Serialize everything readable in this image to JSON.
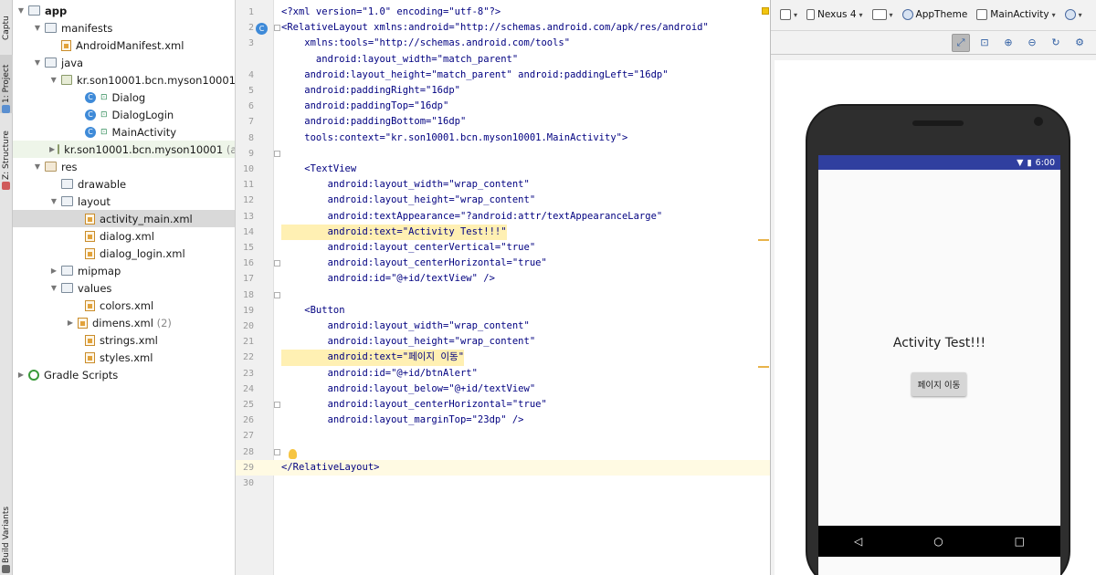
{
  "side_tabs": {
    "capture": "Captu",
    "project": "1: Project",
    "structure": "Z: Structure",
    "build_variants": "Build Variants"
  },
  "tree": {
    "app": "app",
    "manifests": "manifests",
    "android_manifest": "AndroidManifest.xml",
    "java": "java",
    "pkg1": "kr.son10001.bcn.myson10001",
    "dialog": "Dialog",
    "dialog_login": "DialogLogin",
    "main_activity": "MainActivity",
    "pkg2": "kr.son10001.bcn.myson10001",
    "pkg2_suffix": "(an",
    "res": "res",
    "drawable": "drawable",
    "layout": "layout",
    "activity_main": "activity_main.xml",
    "dialog_xml": "dialog.xml",
    "dialog_login_xml": "dialog_login.xml",
    "mipmap": "mipmap",
    "values": "values",
    "colors": "colors.xml",
    "dimens": "dimens.xml",
    "dimens_count": "(2)",
    "strings": "strings.xml",
    "styles": "styles.xml",
    "gradle": "Gradle Scripts"
  },
  "editor": {
    "lines": [
      {
        "n": "1",
        "t": "<?xml version=\"1.0\" encoding=\"utf-8\"?>"
      },
      {
        "n": "2",
        "t": "<RelativeLayout xmlns:android=\"http://schemas.android.com/apk/res/android\""
      },
      {
        "n": "3",
        "t": "    xmlns:tools=\"http://schemas.android.com/tools\""
      },
      {
        "n": "",
        "t": "      android:layout_width=\"match_parent\""
      },
      {
        "n": "4",
        "t": "    android:layout_height=\"match_parent\" android:paddingLeft=\"16dp\""
      },
      {
        "n": "5",
        "t": "    android:paddingRight=\"16dp\""
      },
      {
        "n": "6",
        "t": "    android:paddingTop=\"16dp\""
      },
      {
        "n": "7",
        "t": "    android:paddingBottom=\"16dp\""
      },
      {
        "n": "8",
        "t": "    tools:context=\"kr.son10001.bcn.myson10001.MainActivity\">"
      },
      {
        "n": "9",
        "t": ""
      },
      {
        "n": "10",
        "t": "    <TextView"
      },
      {
        "n": "11",
        "t": "        android:layout_width=\"wrap_content\""
      },
      {
        "n": "12",
        "t": "        android:layout_height=\"wrap_content\""
      },
      {
        "n": "13",
        "t": "        android:textAppearance=\"?android:attr/textAppearanceLarge\""
      },
      {
        "n": "14",
        "t": "        android:text=\"Activity Test!!!\""
      },
      {
        "n": "15",
        "t": "        android:layout_centerVertical=\"true\""
      },
      {
        "n": "16",
        "t": "        android:layout_centerHorizontal=\"true\""
      },
      {
        "n": "17",
        "t": "        android:id=\"@+id/textView\" />"
      },
      {
        "n": "18",
        "t": ""
      },
      {
        "n": "19",
        "t": "    <Button"
      },
      {
        "n": "20",
        "t": "        android:layout_width=\"wrap_content\""
      },
      {
        "n": "21",
        "t": "        android:layout_height=\"wrap_content\""
      },
      {
        "n": "22",
        "t": "        android:text=\"페이지 이동\""
      },
      {
        "n": "23",
        "t": "        android:id=\"@+id/btnAlert\""
      },
      {
        "n": "24",
        "t": "        android:layout_below=\"@+id/textView\""
      },
      {
        "n": "25",
        "t": "        android:layout_centerHorizontal=\"true\""
      },
      {
        "n": "26",
        "t": "        android:layout_marginTop=\"23dp\" />"
      },
      {
        "n": "27",
        "t": ""
      },
      {
        "n": "28",
        "t": ""
      },
      {
        "n": "29",
        "t": "</RelativeLayout>"
      },
      {
        "n": "30",
        "t": ""
      }
    ]
  },
  "preview": {
    "device": "Nexus 4",
    "theme": "AppTheme",
    "activity": "MainActivity",
    "status_time": "6:00",
    "app_text": "Activity Test!!!",
    "app_button": "페이지 이동"
  }
}
